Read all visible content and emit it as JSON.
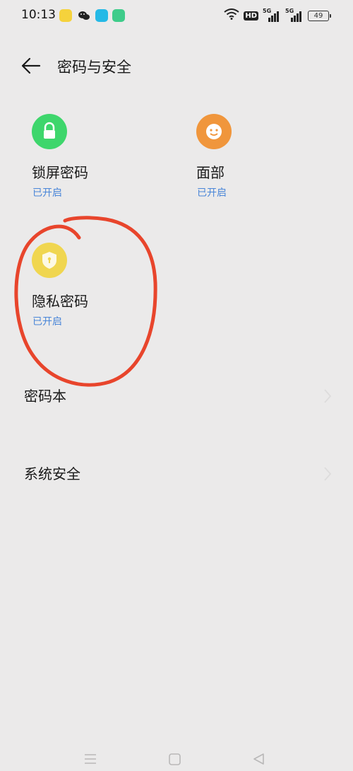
{
  "status_bar": {
    "time": "10:13",
    "battery": "49",
    "network_label_1": "5G",
    "network_label_2": "5G",
    "hd_label": "HD"
  },
  "header": {
    "title": "密码与安全"
  },
  "tiles": [
    {
      "title": "锁屏密码",
      "status": "已开启",
      "icon": "lock-icon",
      "color": "#3ed66c"
    },
    {
      "title": "面部",
      "status": "已开启",
      "icon": "face-icon",
      "color": "#f0963c"
    },
    {
      "title": "隐私密码",
      "status": "已开启",
      "icon": "shield-icon",
      "color": "#f0d650"
    }
  ],
  "rows": [
    {
      "label": "密码本"
    },
    {
      "label": "系统安全"
    }
  ],
  "colors": {
    "background": "#ebeaea",
    "status_text": "#4a86d8",
    "annotation": "#e8452c"
  }
}
